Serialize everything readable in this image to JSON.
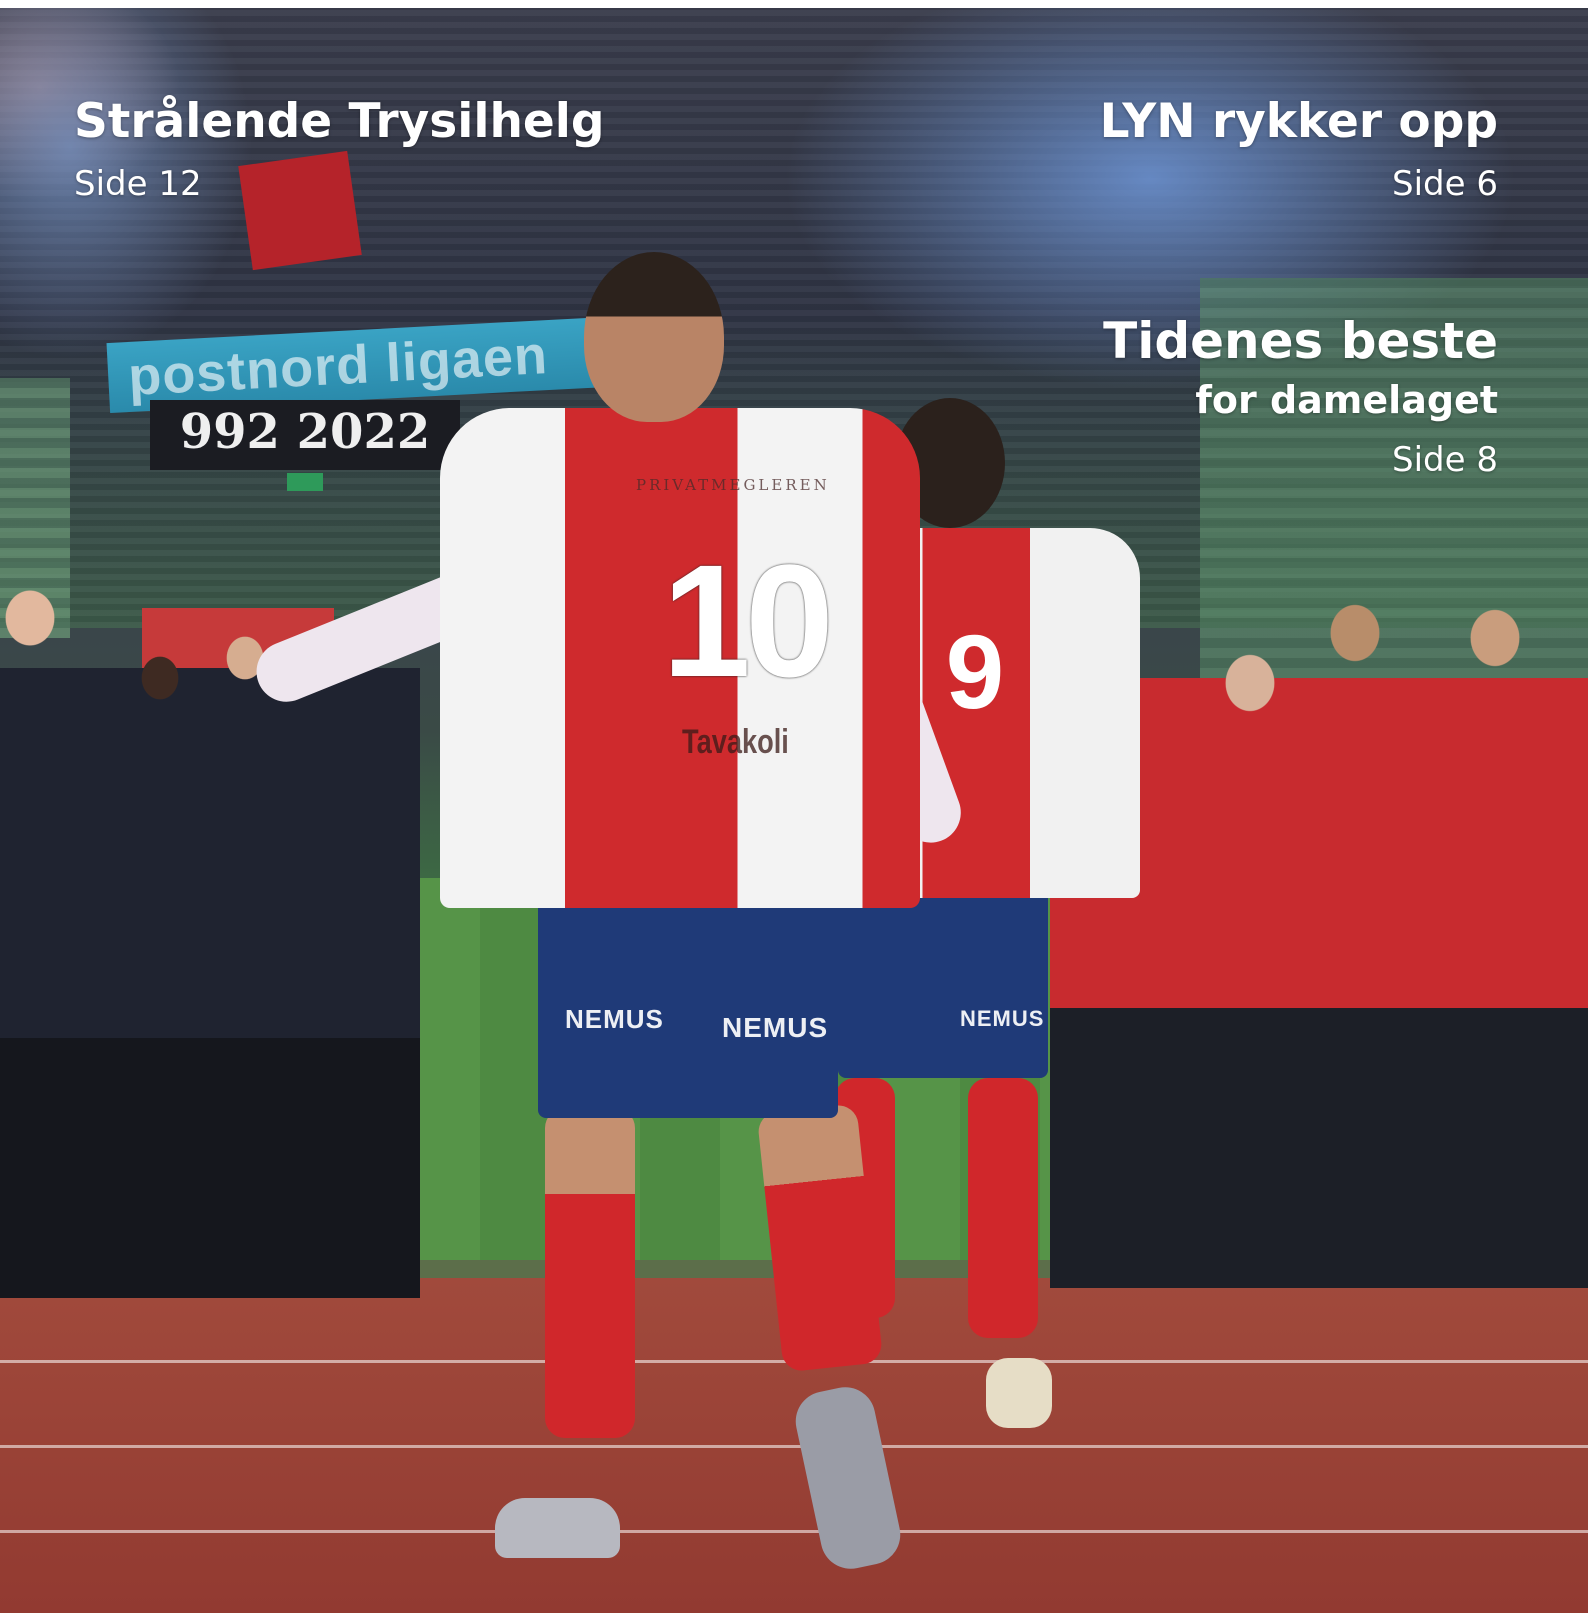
{
  "stories": {
    "trysil": {
      "title": "Strålende Trysilhelg",
      "page": "Side 12"
    },
    "lyn": {
      "title": "LYN rykker opp",
      "page": "Side 6"
    },
    "damelaget": {
      "title": "Tidenes beste",
      "subtitle": "for damelaget",
      "page": "Side 8"
    }
  },
  "photo": {
    "banner_top": "postnord ligaen",
    "banner_bottom": "992 2022",
    "player_main": {
      "number": "10",
      "name": "Tavakoli",
      "shirt_sponsor": "PRIVATMEGLEREN"
    },
    "player_second": {
      "number": "9"
    },
    "shorts_sponsor": "NEMUS",
    "colors": {
      "shirt_red": "#cf2a2d",
      "shirt_white": "#f3f3f3",
      "shorts_blue": "#1f3a78",
      "track": "#9e3f35",
      "pitch": "#4e8a42"
    }
  }
}
